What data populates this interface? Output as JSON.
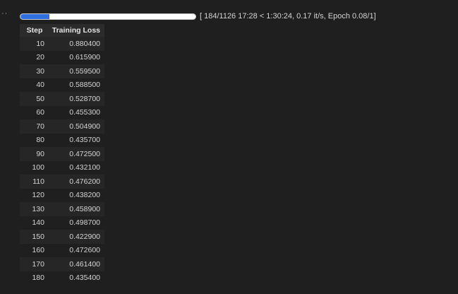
{
  "cell": {
    "gutter_dots": "··"
  },
  "progress": {
    "fraction": 0.1634,
    "text": "[ 184/1126 17:28 < 1:30:24, 0.17 it/s, Epoch 0.08/1]",
    "colors": {
      "fill": "#2f6fdf",
      "track": "#ffffff"
    }
  },
  "table": {
    "headers": [
      "Step",
      "Training Loss"
    ],
    "rows": [
      [
        "10",
        "0.880400"
      ],
      [
        "20",
        "0.615900"
      ],
      [
        "30",
        "0.559500"
      ],
      [
        "40",
        "0.588500"
      ],
      [
        "50",
        "0.528700"
      ],
      [
        "60",
        "0.455300"
      ],
      [
        "70",
        "0.504900"
      ],
      [
        "80",
        "0.435700"
      ],
      [
        "90",
        "0.472500"
      ],
      [
        "100",
        "0.432100"
      ],
      [
        "110",
        "0.476200"
      ],
      [
        "120",
        "0.438200"
      ],
      [
        "130",
        "0.458900"
      ],
      [
        "140",
        "0.498700"
      ],
      [
        "150",
        "0.422900"
      ],
      [
        "160",
        "0.472600"
      ],
      [
        "170",
        "0.461400"
      ],
      [
        "180",
        "0.435400"
      ]
    ]
  }
}
